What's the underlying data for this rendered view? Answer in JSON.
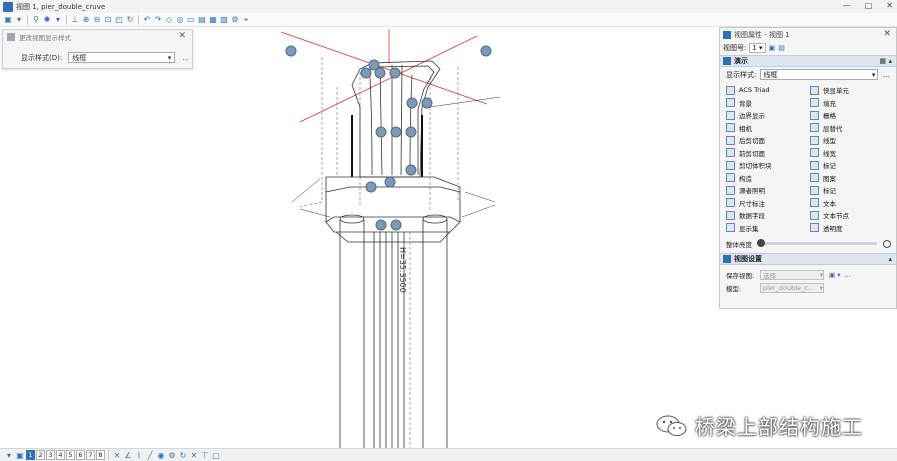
{
  "window": {
    "title": "视图 1, pier_double_cruve",
    "minimize": "—",
    "maximize": "□",
    "close": "✕"
  },
  "toolbar": {
    "icons": [
      "view-icon",
      "dropdown-icon",
      "walk-icon",
      "sun-icon",
      "dropdown-icon",
      "camera-icon",
      "zoom-in-icon",
      "zoom-out-icon",
      "fit-icon",
      "window-area-icon",
      "rotate-icon",
      "undo-view-icon",
      "redo-view-icon",
      "pan-icon",
      "clip-icon",
      "section-icon",
      "display-icon",
      "view-attr-icon",
      "sheet-icon",
      "settings-icon",
      "pointer-icon"
    ]
  },
  "display_style_dialog": {
    "title": "更改视图显示样式",
    "close": "✕",
    "label": "显示样式(D):",
    "value": "线框",
    "more": "..."
  },
  "properties_panel": {
    "title": "视图属性 - 视图 1",
    "close": "✕",
    "view_number_label": "视图号:",
    "view_number": "1",
    "section_presentation": "演示",
    "display_style_label": "显示样式:",
    "display_style_value": "线框",
    "more": "...",
    "attributes": [
      {
        "label": "ACS Triad",
        "icon": "acs-icon"
      },
      {
        "label": "快显单元",
        "icon": "cell-icon"
      },
      {
        "label": "背景",
        "icon": "background-icon"
      },
      {
        "label": "填充",
        "icon": "fill-icon"
      },
      {
        "label": "边界显示",
        "icon": "boundary-icon"
      },
      {
        "label": "栅格",
        "icon": "grid-icon"
      },
      {
        "label": "相机",
        "icon": "camera-icon"
      },
      {
        "label": "层替代",
        "icon": "level-override-icon"
      },
      {
        "label": "后剪切面",
        "icon": "back-clip-icon"
      },
      {
        "label": "线型",
        "icon": "linestyle-icon"
      },
      {
        "label": "前剪切面",
        "icon": "front-clip-icon"
      },
      {
        "label": "线宽",
        "icon": "lineweight-icon"
      },
      {
        "label": "剪切体积块",
        "icon": "clip-volume-icon"
      },
      {
        "label": "标记",
        "icon": "tag-icon"
      },
      {
        "label": "构造",
        "icon": "construction-icon"
      },
      {
        "label": "图案",
        "icon": "pattern-icon"
      },
      {
        "label": "源者照明",
        "icon": "lighting-icon"
      },
      {
        "label": "标记",
        "icon": "marker-icon"
      },
      {
        "label": "尺寸标注",
        "icon": "dimension-icon"
      },
      {
        "label": "文本",
        "icon": "text-icon"
      },
      {
        "label": "数据字段",
        "icon": "data-field-icon"
      },
      {
        "label": "文本节点",
        "icon": "text-node-icon"
      },
      {
        "label": "显示集",
        "icon": "display-set-icon"
      },
      {
        "label": "透明度",
        "icon": "transparency-icon"
      }
    ],
    "brightness_label": "整体亮度",
    "section_view_settings": "视图设置",
    "saved_view_label": "保存视图:",
    "saved_view_value": "选择",
    "model_label": "模型:",
    "model_value": "pier_double_c..."
  },
  "drawing": {
    "dimension_text": "H=35.3500"
  },
  "bottom_bar": {
    "views": [
      "1",
      "2",
      "3",
      "4",
      "5",
      "6",
      "7",
      "8"
    ],
    "active_view": "1"
  },
  "watermark": {
    "text": "桥梁上部结构施工"
  },
  "colors": {
    "accent": "#2f6fb8",
    "axis_red": "#e0302b",
    "marker": "#7f98b3"
  }
}
